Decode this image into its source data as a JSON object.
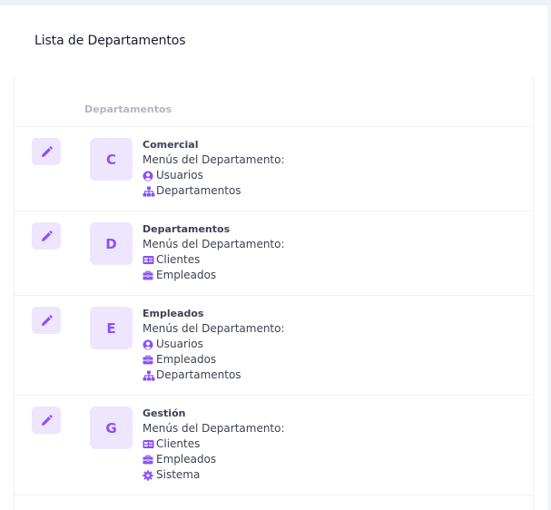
{
  "title": "Lista de Departamentos",
  "column_header": "Departamentos",
  "accent_color": "#8950fc",
  "accent_light": "#eee5ff",
  "departments": [
    {
      "initial": "C",
      "name": "Comercial",
      "menus_label": "Menús del Departamento:",
      "menus": [
        {
          "icon": "user-circle-icon",
          "label": "Usuarios"
        },
        {
          "icon": "sitemap-icon",
          "label": "Departamentos"
        }
      ]
    },
    {
      "initial": "D",
      "name": "Departamentos",
      "menus_label": "Menús del Departamento:",
      "menus": [
        {
          "icon": "id-card-icon",
          "label": "Clientes"
        },
        {
          "icon": "briefcase-icon",
          "label": "Empleados"
        }
      ]
    },
    {
      "initial": "E",
      "name": "Empleados",
      "menus_label": "Menús del Departamento:",
      "menus": [
        {
          "icon": "user-circle-icon",
          "label": "Usuarios"
        },
        {
          "icon": "briefcase-icon",
          "label": "Empleados"
        },
        {
          "icon": "sitemap-icon",
          "label": "Departamentos"
        }
      ]
    },
    {
      "initial": "G",
      "name": "Gestión",
      "menus_label": "Menús del Departamento:",
      "menus": [
        {
          "icon": "id-card-icon",
          "label": "Clientes"
        },
        {
          "icon": "briefcase-icon",
          "label": "Empleados"
        },
        {
          "icon": "gear-icon",
          "label": "Sistema"
        }
      ]
    }
  ]
}
